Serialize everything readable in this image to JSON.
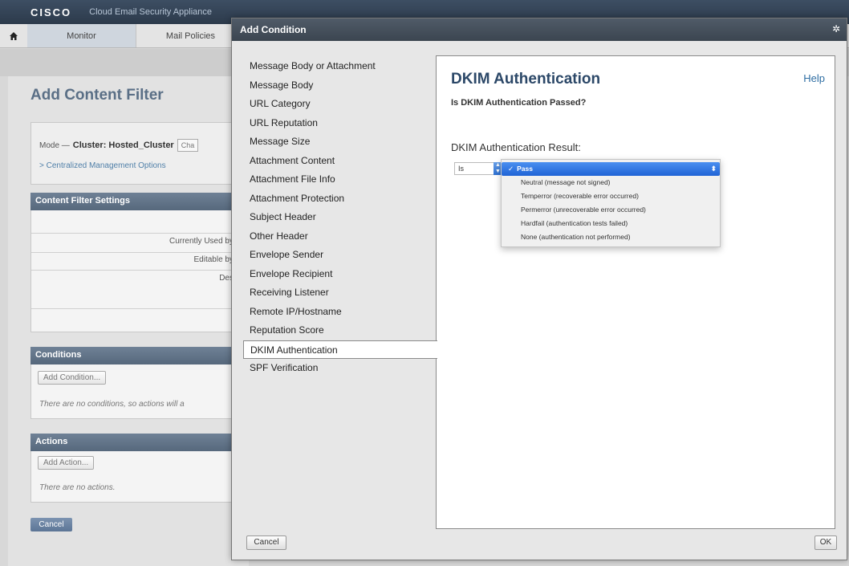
{
  "app": {
    "brand": "CISCO",
    "product": "Cloud Email Security Appliance"
  },
  "nav": {
    "tabs": [
      {
        "label": "Monitor"
      },
      {
        "label": "Mail Policies"
      }
    ]
  },
  "page": {
    "title": "Add Content Filter",
    "mode_label": "Mode —",
    "mode_value": "Cluster: Hosted_Cluster",
    "change_mode_label": "Cha",
    "centralized_options": "> Centralized Management Options",
    "settings_header": "Content Filter Settings",
    "settings_rows": [
      "Currently Used by",
      "Editable by",
      "Des"
    ],
    "conditions_header": "Conditions",
    "add_condition_label": "Add Condition...",
    "conditions_empty": "There are no conditions, so actions will a",
    "actions_header": "Actions",
    "add_action_label": "Add Action...",
    "actions_empty": "There are no actions.",
    "cancel_label": "Cancel"
  },
  "modal": {
    "title": "Add Condition",
    "conditions": [
      "Message Body or Attachment",
      "Message Body",
      "URL Category",
      "URL Reputation",
      "Message Size",
      "Attachment Content",
      "Attachment File Info",
      "Attachment Protection",
      "Subject Header",
      "Other Header",
      "Envelope Sender",
      "Envelope Recipient",
      "Receiving Listener",
      "Remote IP/Hostname",
      "Reputation Score",
      "DKIM Authentication",
      "SPF Verification"
    ],
    "selected_index": 15,
    "detail": {
      "title": "DKIM Authentication",
      "help": "Help",
      "subtitle": "Is DKIM Authentication Passed?",
      "result_label": "DKIM Authentication Result:",
      "operator": "Is",
      "selected_option": "Pass",
      "options": [
        "Neutral (message not signed)",
        "Temperror (recoverable error occurred)",
        "Permerror (unrecoverable error occurred)",
        "Hardfail (authentication tests failed)",
        "None (authentication not performed)"
      ]
    },
    "cancel_label": "Cancel",
    "ok_label": "OK"
  },
  "colors": {
    "accent": "#2c4868",
    "selection_blue": "#2c6fd1",
    "header_bar": "#56687c"
  }
}
